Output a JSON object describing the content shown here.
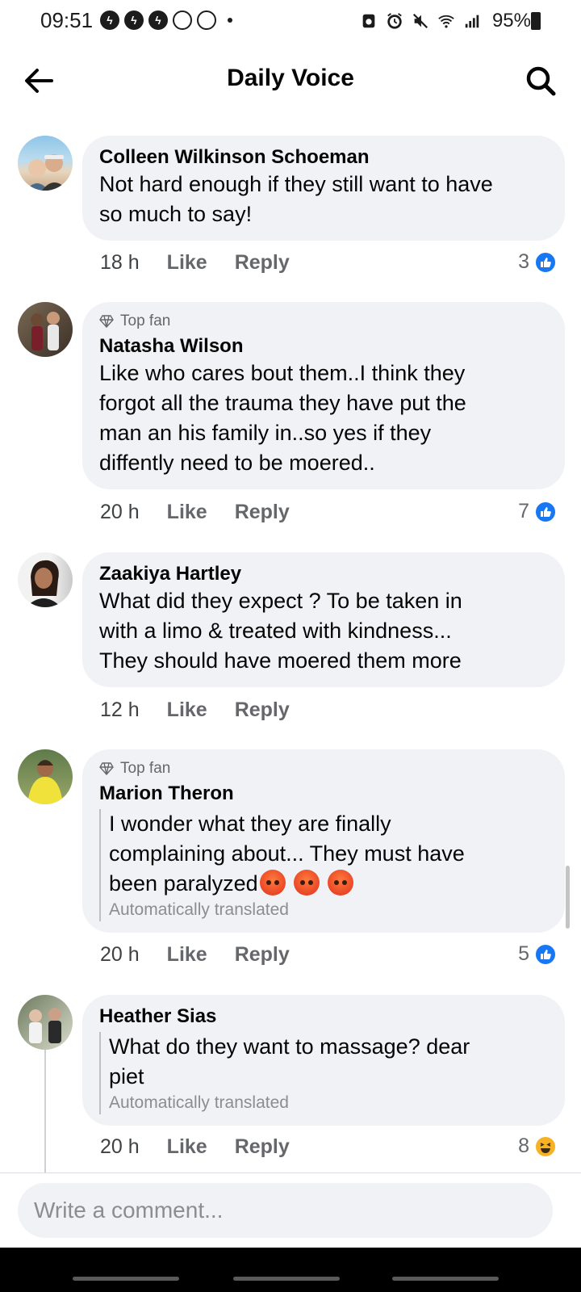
{
  "status_bar": {
    "time": "09:51",
    "battery": "95%",
    "left_icons": [
      "messenger-icon",
      "messenger-icon",
      "messenger-icon",
      "recycle-icon",
      "recycle-icon"
    ],
    "right_icons": [
      "nfc-icon",
      "alarm-icon",
      "mute-icon",
      "wifi-icon",
      "signal-icon"
    ]
  },
  "header": {
    "title": "Daily Voice"
  },
  "comments": [
    {
      "top_fan": "",
      "author": "Colleen Wilkinson Schoeman",
      "text_lines": [
        "Not hard enough if they still want to have",
        "so much to say!"
      ],
      "time": "18 h",
      "like": "Like",
      "reply": "Reply",
      "reaction_count": "3",
      "reaction": "like"
    },
    {
      "top_fan": "Top fan",
      "author": "Natasha Wilson",
      "text_lines": [
        "Like who cares bout them..I think they",
        "forgot all the trauma they have put the",
        "man an his family in..so yes if they",
        "diffently need to be moered.."
      ],
      "time": "20 h",
      "like": "Like",
      "reply": "Reply",
      "reaction_count": "7",
      "reaction": "like"
    },
    {
      "top_fan": "",
      "author": "Zaakiya Hartley",
      "text_lines": [
        "What did they expect ? To be taken in",
        "with a limo & treated with kindness...",
        "They should have moered them more"
      ],
      "time": "12 h",
      "like": "Like",
      "reply": "Reply",
      "reaction_count": "",
      "reaction": ""
    },
    {
      "top_fan": "Top fan",
      "author": "Marion Theron",
      "text_lines": [
        "I wonder what they are finally",
        "complaining about... They must have",
        "been paralyzed"
      ],
      "translated_label": "Automatically translated",
      "time": "20 h",
      "like": "Like",
      "reply": "Reply",
      "reaction_count": "5",
      "reaction": "like"
    },
    {
      "top_fan": "",
      "author": "Heather Sias",
      "text_lines": [
        "What do they want to massage? dear",
        "piet"
      ],
      "translated_label": "Automatically translated",
      "time": "20 h",
      "like": "Like",
      "reply": "Reply",
      "reaction_count": "8",
      "reaction": "haha"
    }
  ],
  "composer": {
    "placeholder": "Write a comment..."
  },
  "colors": {
    "bubble": "#f0f2f5",
    "like_blue": "#1877f2",
    "meta_gray": "#65676b"
  }
}
